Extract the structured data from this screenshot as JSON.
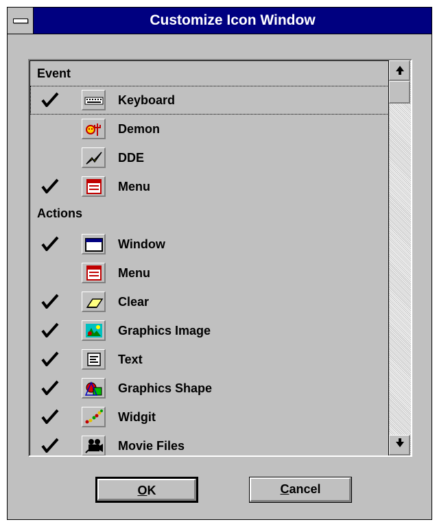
{
  "window": {
    "title": "Customize Icon Window"
  },
  "list": {
    "sections": [
      {
        "label": "Event",
        "items": [
          {
            "label": "Keyboard",
            "checked": true,
            "icon": "keyboard-icon",
            "focused": true
          },
          {
            "label": "Demon",
            "checked": false,
            "icon": "demon-icon"
          },
          {
            "label": "DDE",
            "checked": false,
            "icon": "dde-lightning-icon"
          },
          {
            "label": "Menu",
            "checked": true,
            "icon": "menu-icon"
          }
        ]
      },
      {
        "label": "Actions",
        "items": [
          {
            "label": "Window",
            "checked": true,
            "icon": "window-icon"
          },
          {
            "label": "Menu",
            "checked": false,
            "icon": "menu-icon"
          },
          {
            "label": "Clear",
            "checked": true,
            "icon": "eraser-icon"
          },
          {
            "label": "Graphics Image",
            "checked": true,
            "icon": "graphics-image-icon"
          },
          {
            "label": "Text",
            "checked": true,
            "icon": "text-icon"
          },
          {
            "label": "Graphics Shape",
            "checked": true,
            "icon": "graphics-shape-icon"
          },
          {
            "label": "Widgit",
            "checked": true,
            "icon": "widgit-icon"
          },
          {
            "label": "Movie Files",
            "checked": true,
            "icon": "movie-camera-icon"
          }
        ]
      }
    ]
  },
  "buttons": {
    "ok_prefix": "O",
    "ok_rest": "K",
    "cancel_prefix": "C",
    "cancel_rest": "ancel"
  },
  "colors": {
    "titlebar": "#000080",
    "face": "#c0c0c0"
  }
}
